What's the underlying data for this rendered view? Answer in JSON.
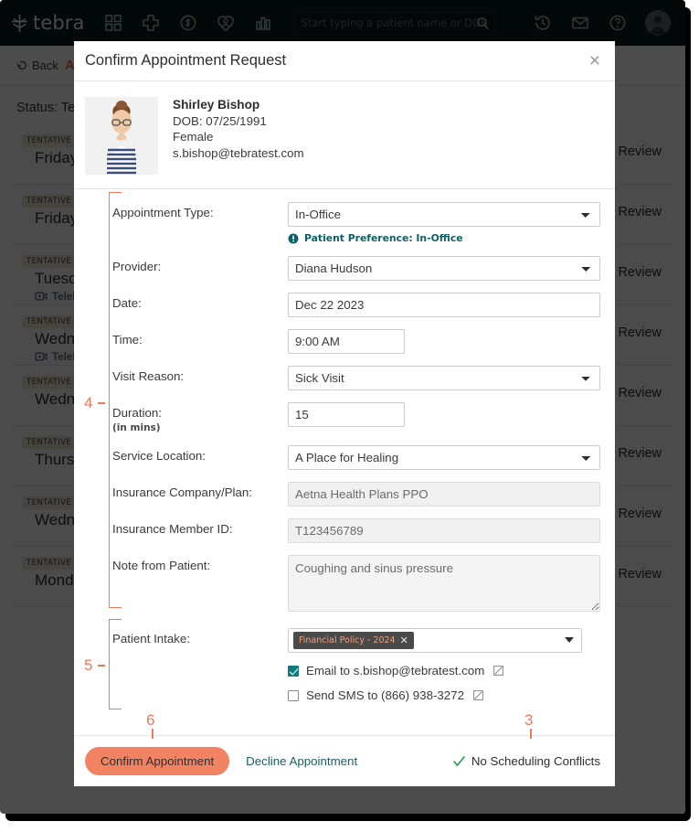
{
  "topnav": {
    "brand": "tebra",
    "icons": [
      {
        "name": "dashboard-grid-icon",
        "label": "Dashboard"
      },
      {
        "name": "medical-cross-icon",
        "label": "Clinical"
      },
      {
        "name": "dollar-circle-icon",
        "label": "Billing"
      },
      {
        "name": "patient-heart-icon",
        "label": "Patients"
      },
      {
        "name": "bar-chart-icon",
        "label": "Reports"
      }
    ],
    "search": {
      "placeholder": "Start typing a patient name or DOB"
    },
    "right_icons": [
      {
        "name": "history-clock-icon",
        "label": "Recent"
      },
      {
        "name": "envelope-icon",
        "label": "Messages"
      },
      {
        "name": "help-circle-icon",
        "label": "Help"
      },
      {
        "name": "user-avatar-icon",
        "label": "Account"
      }
    ]
  },
  "page": {
    "back_label": "Back",
    "crumb_title": "A",
    "status_label": "Status: Ten",
    "rows": [
      {
        "badge": "TENTATIVE",
        "day": "Friday,",
        "tele": "",
        "action": "Review"
      },
      {
        "badge": "TENTATIVE",
        "day": "Friday,",
        "tele": "",
        "action": "Review"
      },
      {
        "badge": "TENTATIVE",
        "day": "Tuesda",
        "tele": "Teleh",
        "action": "Review"
      },
      {
        "badge": "TENTATIVE",
        "day": "Wednes",
        "tele": "Teleh",
        "action": "Review"
      },
      {
        "badge": "TENTATIVE",
        "day": "Wednes",
        "tele": "",
        "action": "Review"
      },
      {
        "badge": "TENTATIVE",
        "day": "Thursd",
        "tele": "",
        "action": "Review"
      },
      {
        "badge": "TENTATIVE",
        "day": "Wednes",
        "tele": "",
        "action": "Review"
      },
      {
        "badge": "TENTATIVE",
        "day": "Monday",
        "tele": "",
        "action": "Review"
      }
    ]
  },
  "modal": {
    "title": "Confirm Appointment Request",
    "close_label": "×",
    "patient": {
      "name": "Shirley Bishop",
      "dob": "DOB: 07/25/1991",
      "gender": "Female",
      "email": "s.bishop@tebratest.com"
    },
    "form": {
      "appointment_type": {
        "label": "Appointment Type:",
        "value": "In-Office",
        "note": "Patient Preference: In-Office"
      },
      "provider": {
        "label": "Provider:",
        "value": "Diana Hudson"
      },
      "date": {
        "label": "Date:",
        "value": "Dec 22 2023"
      },
      "time": {
        "label": "Time:",
        "value": "9:00 AM"
      },
      "visit_reason": {
        "label": "Visit Reason:",
        "value": "Sick Visit"
      },
      "duration": {
        "label": "Duration:",
        "sub": "(in mins)",
        "value": "15"
      },
      "service_location": {
        "label": "Service Location:",
        "value": "A Place for Healing"
      },
      "insurance_plan": {
        "label": "Insurance Company/Plan:",
        "value": "Aetna Health Plans PPO"
      },
      "insurance_member_id": {
        "label": "Insurance Member ID:",
        "value": "T123456789"
      },
      "note_from_patient": {
        "label": "Note from Patient:",
        "value": "Coughing and sinus pressure"
      },
      "patient_intake": {
        "label": "Patient Intake:",
        "tag": "Financial Policy - 2024",
        "tag_remove": "✕",
        "email_option": "Email to s.bishop@tebratest.com",
        "email_checked": true,
        "sms_option": "Send SMS to (866) 938-3272",
        "sms_checked": false
      }
    },
    "footer": {
      "confirm_label": "Confirm Appointment",
      "decline_label": "Decline Appointment",
      "conflicts_label": "No Scheduling Conflicts"
    }
  },
  "annotations": {
    "marker_4": "4",
    "marker_5": "5",
    "marker_6": "6",
    "marker_3": "3",
    "color": "#f0795a"
  }
}
